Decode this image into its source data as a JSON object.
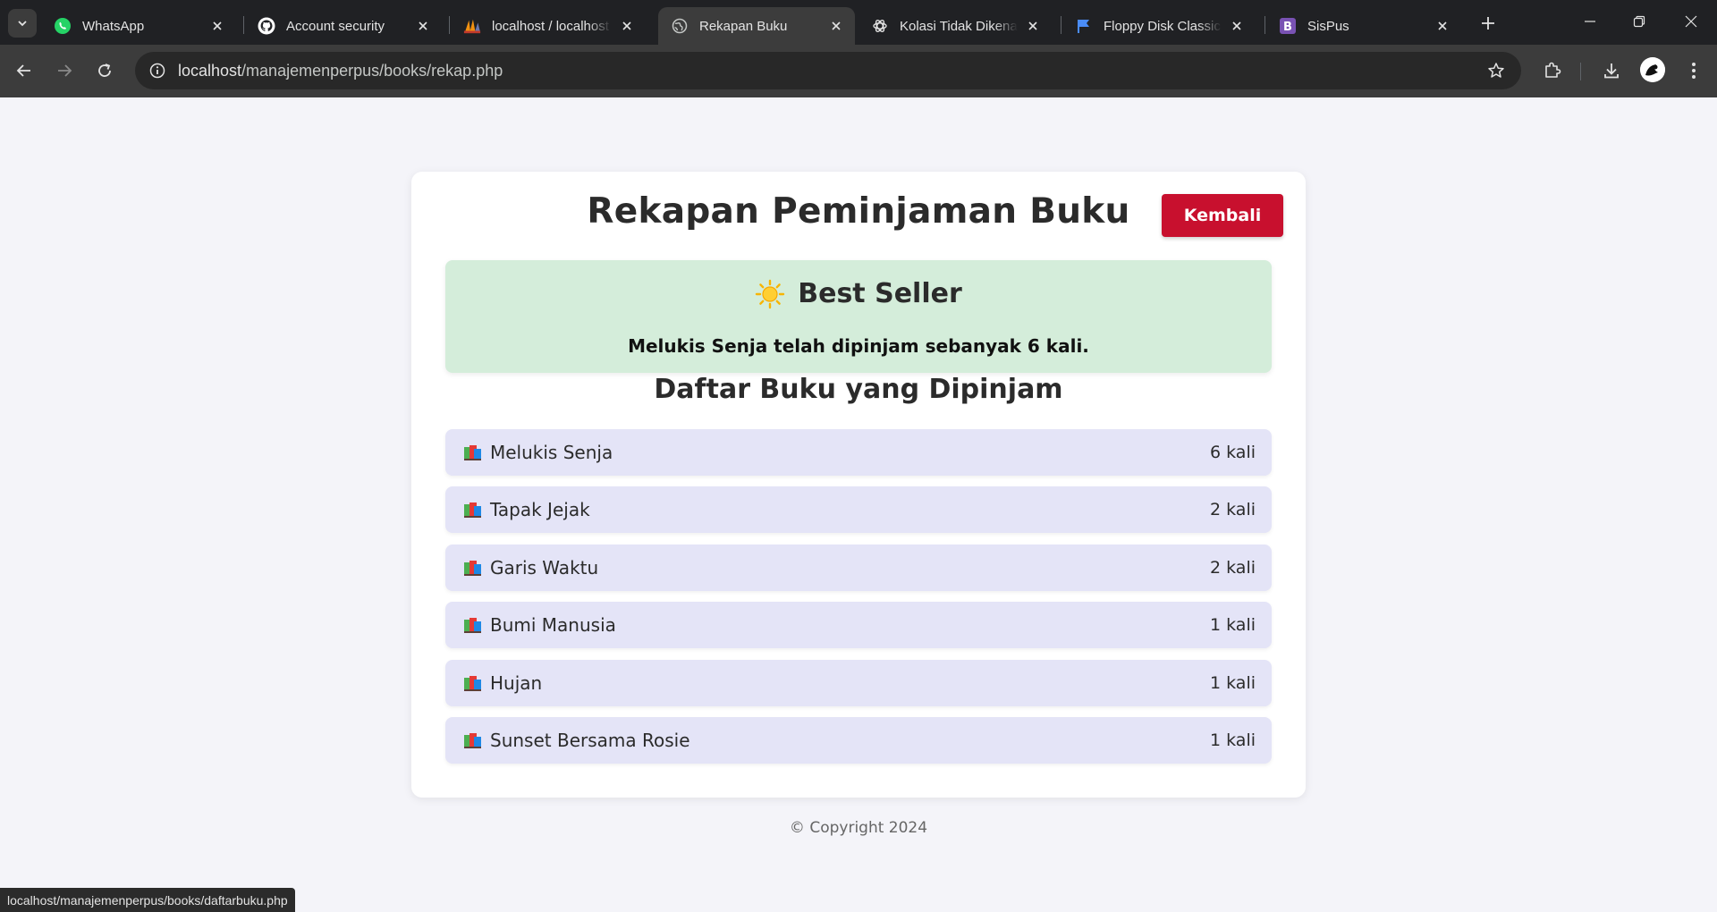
{
  "browser": {
    "tabs": [
      {
        "title": "WhatsApp",
        "icon": "whatsapp-icon",
        "active": false
      },
      {
        "title": "Account security",
        "icon": "github-icon",
        "active": false
      },
      {
        "title": "localhost / localhost / ",
        "icon": "phpmyadmin-icon",
        "active": false
      },
      {
        "title": "Rekapan Buku",
        "icon": "globe-icon",
        "active": true
      },
      {
        "title": "Kolasi Tidak Dikenal U",
        "icon": "chatgpt-icon",
        "active": false
      },
      {
        "title": "Floppy Disk Classic Li",
        "icon": "flag-icon",
        "active": false
      },
      {
        "title": "SisPus",
        "icon": "bootstrap-icon",
        "active": false
      }
    ],
    "address": {
      "host": "localhost",
      "path": "/manajemenperpus/books/rekap.php"
    },
    "status_url": "localhost/manajemenperpus/books/daftarbuku.php"
  },
  "page": {
    "title": "Rekapan Peminjaman Buku",
    "back_label": "Kembali",
    "best_seller": {
      "heading": "Best Seller",
      "text": "Melukis Senja telah dipinjam sebanyak 6 kali."
    },
    "list_title": "Daftar Buku yang Dipinjam",
    "books": [
      {
        "name": "Melukis Senja",
        "count": "6 kali"
      },
      {
        "name": "Tapak Jejak",
        "count": "2 kali"
      },
      {
        "name": "Garis Waktu",
        "count": "2 kali"
      },
      {
        "name": "Bumi Manusia",
        "count": "1 kali"
      },
      {
        "name": "Hujan",
        "count": "1 kali"
      },
      {
        "name": "Sunset Bersama Rosie",
        "count": "1 kali"
      }
    ],
    "footer": "© Copyright 2024"
  },
  "colors": {
    "back_button": "#c8102e",
    "best_seller_bg": "#d4edda",
    "book_item_bg": "#e4e4f7",
    "page_bg": "#f4f4f9"
  }
}
